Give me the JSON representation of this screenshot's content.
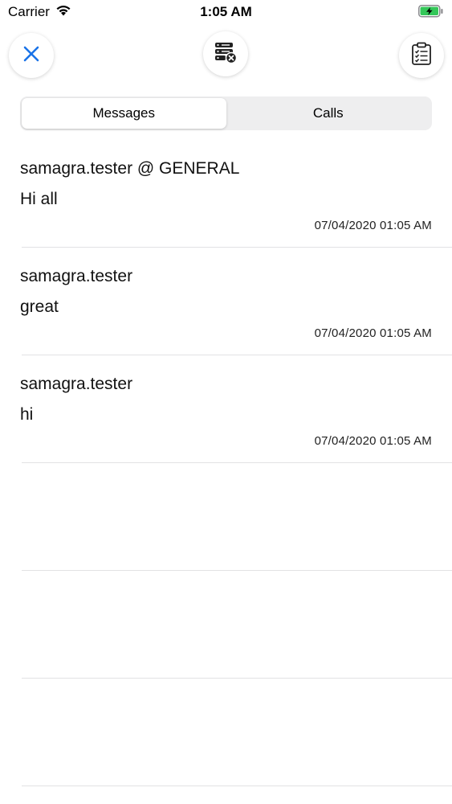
{
  "status_bar": {
    "carrier": "Carrier",
    "time": "1:05 AM",
    "battery_color": "#34c759"
  },
  "toolbar": {
    "close_icon": "close-icon",
    "server_icon": "server-remove-icon",
    "clipboard_icon": "clipboard-checklist-icon",
    "accent_color": "#1a73e8"
  },
  "tabs": [
    {
      "label": "Messages",
      "active": true
    },
    {
      "label": "Calls",
      "active": false
    }
  ],
  "messages": [
    {
      "sender": "samagra.tester @ GENERAL",
      "text": "Hi all",
      "time": "07/04/2020 01:05 AM"
    },
    {
      "sender": "samagra.tester",
      "text": "great",
      "time": "07/04/2020 01:05 AM"
    },
    {
      "sender": "samagra.tester",
      "text": "hi",
      "time": "07/04/2020 01:05 AM"
    }
  ]
}
